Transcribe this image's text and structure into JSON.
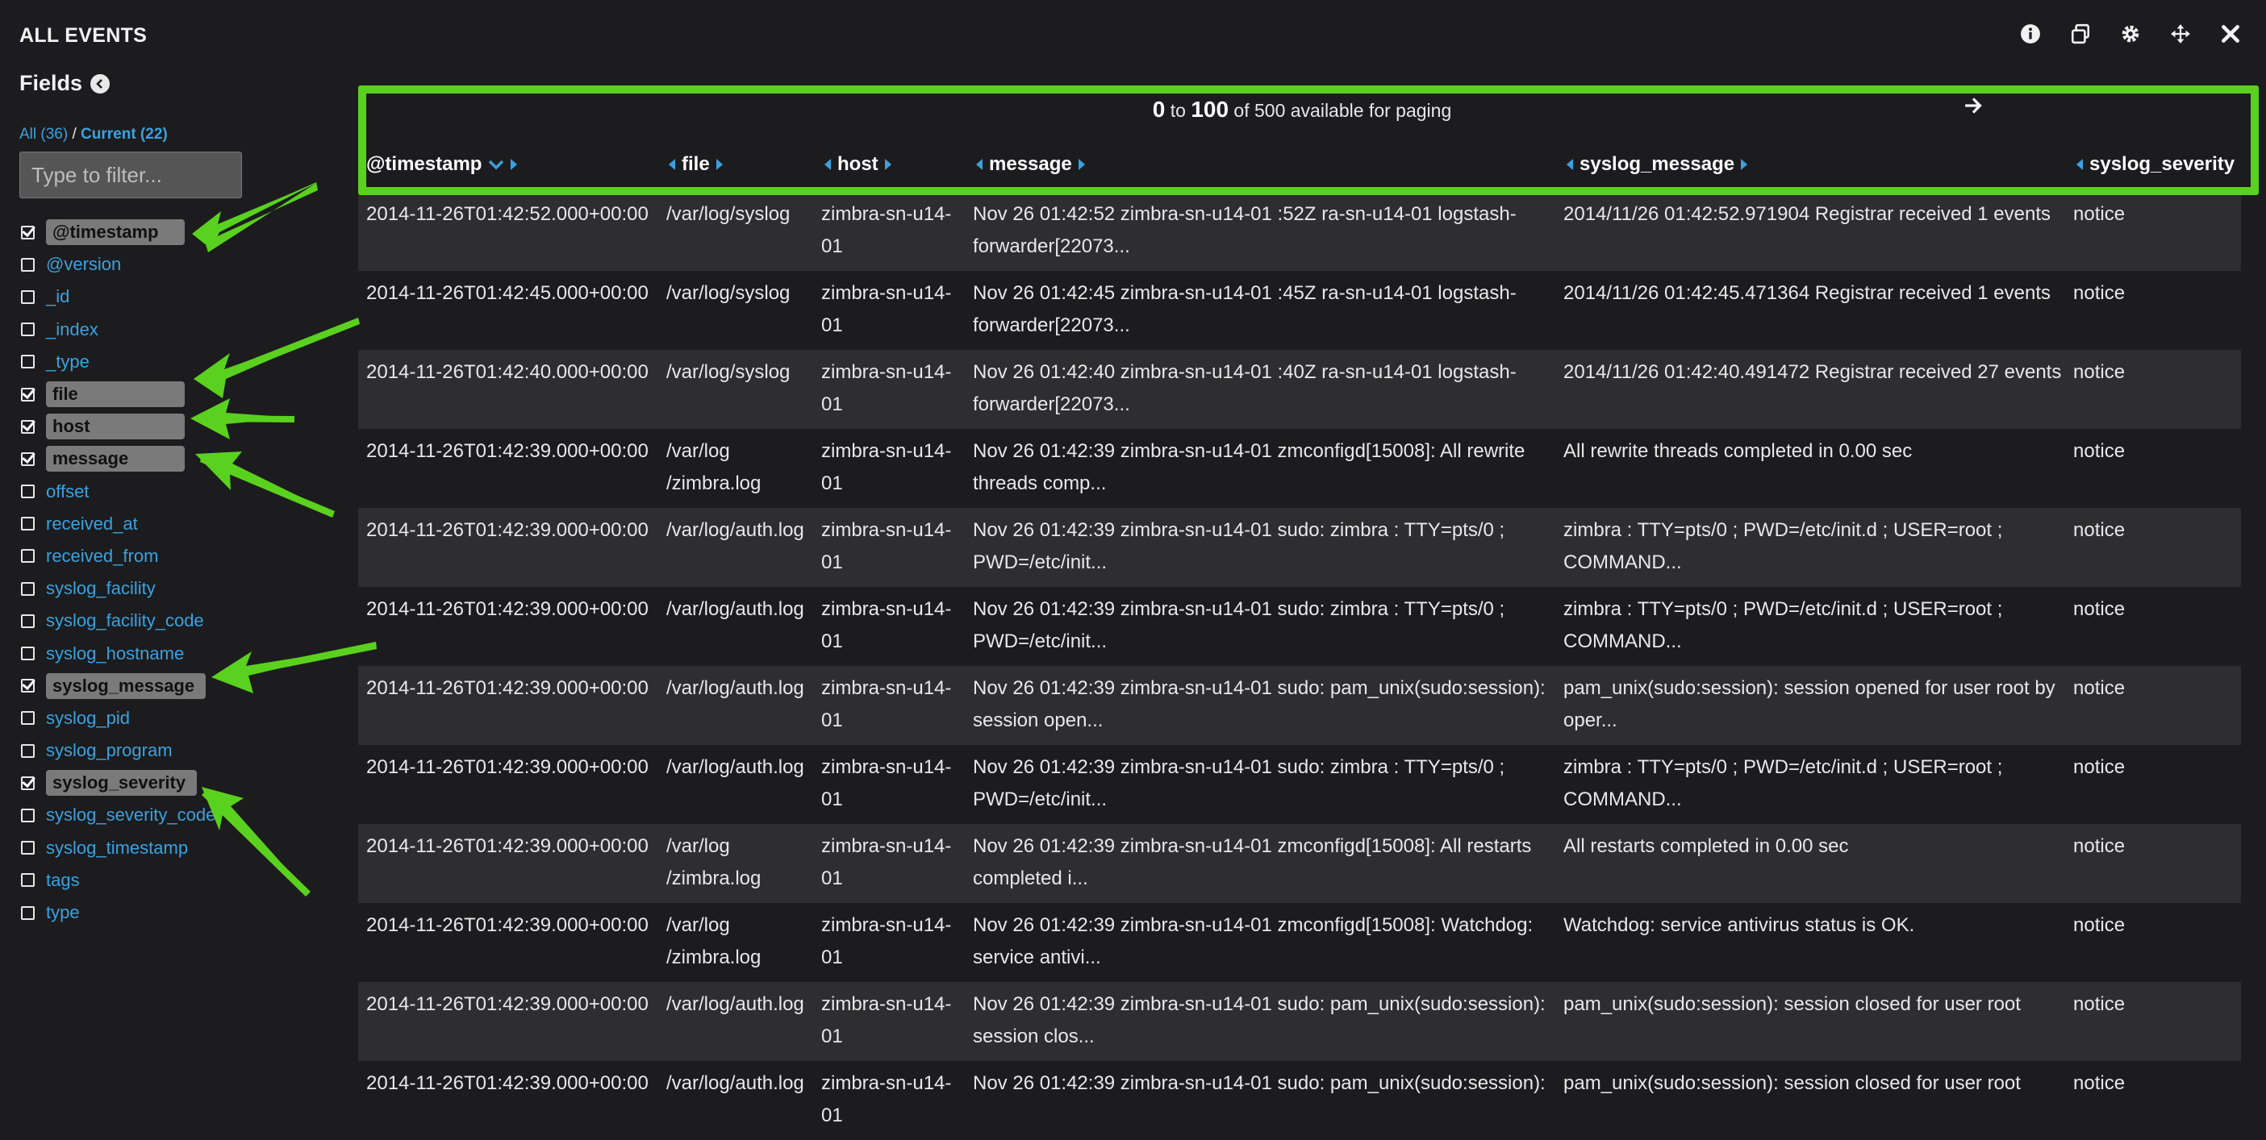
{
  "panel": {
    "title": "ALL EVENTS"
  },
  "sidebar": {
    "heading": "Fields",
    "tab_all": "All (36)",
    "tab_sep": "/",
    "tab_current": "Current (22)",
    "filter_placeholder": "Type to filter...",
    "fields": [
      {
        "name": "@timestamp",
        "checked": true
      },
      {
        "name": "@version",
        "checked": false
      },
      {
        "name": "_id",
        "checked": false
      },
      {
        "name": "_index",
        "checked": false
      },
      {
        "name": "_type",
        "checked": false
      },
      {
        "name": "file",
        "checked": true
      },
      {
        "name": "host",
        "checked": true
      },
      {
        "name": "message",
        "checked": true
      },
      {
        "name": "offset",
        "checked": false
      },
      {
        "name": "received_at",
        "checked": false
      },
      {
        "name": "received_from",
        "checked": false
      },
      {
        "name": "syslog_facility",
        "checked": false
      },
      {
        "name": "syslog_facility_code",
        "checked": false
      },
      {
        "name": "syslog_hostname",
        "checked": false
      },
      {
        "name": "syslog_message",
        "checked": true
      },
      {
        "name": "syslog_pid",
        "checked": false
      },
      {
        "name": "syslog_program",
        "checked": false
      },
      {
        "name": "syslog_severity",
        "checked": true
      },
      {
        "name": "syslog_severity_code",
        "checked": false
      },
      {
        "name": "syslog_timestamp",
        "checked": false
      },
      {
        "name": "tags",
        "checked": false
      },
      {
        "name": "type",
        "checked": false
      }
    ]
  },
  "paging": {
    "from": "0",
    "to_word": "to",
    "to": "100",
    "suffix": "of 500 available for paging"
  },
  "columns": {
    "timestamp": "@timestamp",
    "file": "file",
    "host": "host",
    "message": "message",
    "syslog_message": "syslog_message",
    "syslog_severity": "syslog_severity"
  },
  "rows": [
    {
      "ts": "2014-11-26T01:42:52.000+00:00",
      "file": "/var/log/syslog",
      "host": "zimbra-sn-u14-01",
      "msg": "Nov 26 01:42:52 zimbra-sn-u14-01 :52Z ra-sn-u14-01 logstash-forwarder[22073...",
      "sys": "2014/11/26 01:42:52.971904 Registrar received 1 events",
      "sev": "notice"
    },
    {
      "ts": "2014-11-26T01:42:45.000+00:00",
      "file": "/var/log/syslog",
      "host": "zimbra-sn-u14-01",
      "msg": "Nov 26 01:42:45 zimbra-sn-u14-01 :45Z ra-sn-u14-01 logstash-forwarder[22073...",
      "sys": "2014/11/26 01:42:45.471364 Registrar received 1 events",
      "sev": "notice"
    },
    {
      "ts": "2014-11-26T01:42:40.000+00:00",
      "file": "/var/log/syslog",
      "host": "zimbra-sn-u14-01",
      "msg": "Nov 26 01:42:40 zimbra-sn-u14-01 :40Z ra-sn-u14-01 logstash-forwarder[22073...",
      "sys": "2014/11/26 01:42:40.491472 Registrar received 27 events",
      "sev": "notice"
    },
    {
      "ts": "2014-11-26T01:42:39.000+00:00",
      "file": "/var/log /zimbra.log",
      "host": "zimbra-sn-u14-01",
      "msg": "Nov 26 01:42:39 zimbra-sn-u14-01 zmconfigd[15008]: All rewrite threads comp...",
      "sys": "All rewrite threads completed in 0.00 sec",
      "sev": "notice"
    },
    {
      "ts": "2014-11-26T01:42:39.000+00:00",
      "file": "/var/log/auth.log",
      "host": "zimbra-sn-u14-01",
      "msg": "Nov 26 01:42:39 zimbra-sn-u14-01 sudo:   zimbra : TTY=pts/0 ; PWD=/etc/init...",
      "sys": "  zimbra : TTY=pts/0 ; PWD=/etc/init.d ; USER=root ; COMMAND...",
      "sev": "notice"
    },
    {
      "ts": "2014-11-26T01:42:39.000+00:00",
      "file": "/var/log/auth.log",
      "host": "zimbra-sn-u14-01",
      "msg": "Nov 26 01:42:39 zimbra-sn-u14-01 sudo:   zimbra : TTY=pts/0 ; PWD=/etc/init...",
      "sys": "  zimbra : TTY=pts/0 ; PWD=/etc/init.d ; USER=root ; COMMAND...",
      "sev": "notice"
    },
    {
      "ts": "2014-11-26T01:42:39.000+00:00",
      "file": "/var/log/auth.log",
      "host": "zimbra-sn-u14-01",
      "msg": "Nov 26 01:42:39 zimbra-sn-u14-01 sudo: pam_unix(sudo:session): session open...",
      "sys": "pam_unix(sudo:session): session opened for user root by oper...",
      "sev": "notice"
    },
    {
      "ts": "2014-11-26T01:42:39.000+00:00",
      "file": "/var/log/auth.log",
      "host": "zimbra-sn-u14-01",
      "msg": "Nov 26 01:42:39 zimbra-sn-u14-01 sudo:   zimbra : TTY=pts/0 ; PWD=/etc/init...",
      "sys": "  zimbra : TTY=pts/0 ; PWD=/etc/init.d ; USER=root ; COMMAND...",
      "sev": "notice"
    },
    {
      "ts": "2014-11-26T01:42:39.000+00:00",
      "file": "/var/log /zimbra.log",
      "host": "zimbra-sn-u14-01",
      "msg": "Nov 26 01:42:39 zimbra-sn-u14-01 zmconfigd[15008]: All restarts completed i...",
      "sys": "All restarts completed in 0.00 sec",
      "sev": "notice"
    },
    {
      "ts": "2014-11-26T01:42:39.000+00:00",
      "file": "/var/log /zimbra.log",
      "host": "zimbra-sn-u14-01",
      "msg": "Nov 26 01:42:39 zimbra-sn-u14-01 zmconfigd[15008]: Watchdog: service antivi...",
      "sys": "Watchdog: service antivirus status is OK.",
      "sev": "notice"
    },
    {
      "ts": "2014-11-26T01:42:39.000+00:00",
      "file": "/var/log/auth.log",
      "host": "zimbra-sn-u14-01",
      "msg": "Nov 26 01:42:39 zimbra-sn-u14-01 sudo: pam_unix(sudo:session): session clos...",
      "sys": "pam_unix(sudo:session): session closed for user root",
      "sev": "notice"
    },
    {
      "ts": "2014-11-26T01:42:39.000+00:00",
      "file": "/var/log/auth.log",
      "host": "zimbra-sn-u14-01",
      "msg": "Nov 26 01:42:39 zimbra-sn-u14-01 sudo: pam_unix(sudo:session):",
      "sys": "pam_unix(sudo:session): session closed for user root",
      "sev": "notice"
    }
  ],
  "colors": {
    "accent_link": "#3aa2e0",
    "highlight_green": "#5ad11e",
    "background": "#1c1c1e",
    "row_alt": "#2e2e30"
  },
  "icons": [
    "info-icon",
    "duplicate-icon",
    "gear-icon",
    "move-icon",
    "close-icon",
    "collapse-left-icon",
    "next-page-icon",
    "sort-desc-icon"
  ]
}
